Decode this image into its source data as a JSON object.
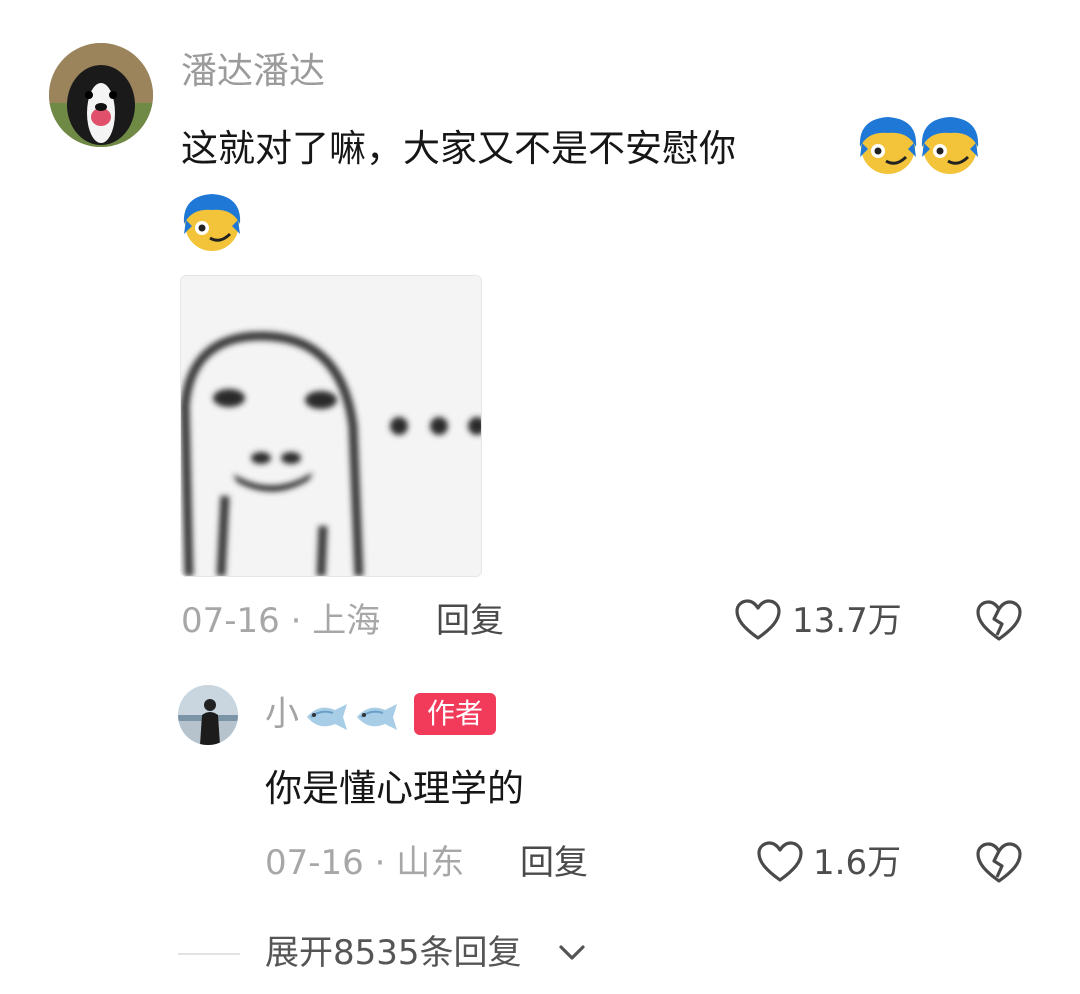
{
  "comment": {
    "username": "潘达潘达",
    "text": "这就对了嘛，大家又不是不安慰你",
    "emoji_icon": "blue-hair-face-emoji",
    "sticker_icon": "blurry-meme-face-sticker",
    "sticker_text": "···",
    "date": "07-16",
    "separator": "·",
    "location": "上海",
    "reply_label": "回复",
    "likes": "13.7万"
  },
  "reply": {
    "username_prefix": "小",
    "username_icon": "fish-emoji",
    "badge": "作者",
    "text": "你是懂心理学的",
    "date": "07-16",
    "separator": "·",
    "location": "山东",
    "reply_label": "回复",
    "likes": "1.6万"
  },
  "expand": {
    "label": "展开8535条回复"
  },
  "colors": {
    "badge": "#f23b5a",
    "muted": "#a7a7a7",
    "text": "#161616"
  }
}
